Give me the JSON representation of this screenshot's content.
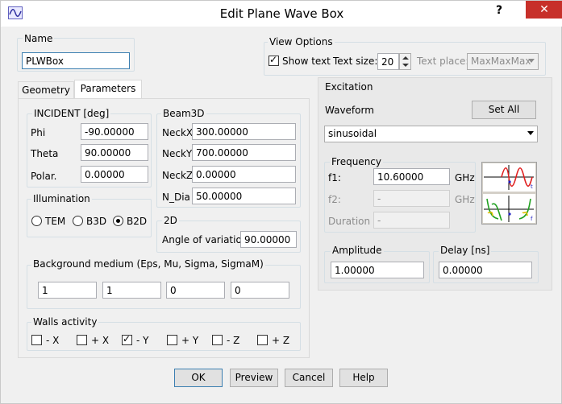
{
  "window": {
    "title": "Edit Plane Wave Box",
    "help": "?",
    "close": "✕"
  },
  "name_group": {
    "legend": "Name",
    "value": "PLWBox"
  },
  "view_options": {
    "legend": "View Options",
    "show_text_label": "Show text",
    "show_text_checked": true,
    "text_size_label": "Text size:",
    "text_size_value": "20",
    "text_place_label": "Text place:",
    "text_place_value": "MaxMaxMax"
  },
  "tabs": [
    {
      "label": "Geometry",
      "active": false
    },
    {
      "label": "Parameters",
      "active": true
    }
  ],
  "incident": {
    "legend": "INCIDENT [deg]",
    "phi_label": "Phi",
    "phi": "-90.00000",
    "theta_label": "Theta",
    "theta": "90.00000",
    "polar_label": "Polar.",
    "polar": "0.00000"
  },
  "beam3d": {
    "legend": "Beam3D",
    "neckx_label": "NeckX",
    "neckx": "300.00000",
    "necky_label": "NeckY",
    "necky": "700.00000",
    "neckz_label": "NeckZ",
    "neckz": "0.00000",
    "ndia_label": "N_Dia",
    "ndia": "50.00000"
  },
  "illumination": {
    "legend": "Illumination",
    "options": [
      {
        "label": "TEM",
        "selected": false
      },
      {
        "label": "B3D",
        "selected": false
      },
      {
        "label": "B2D",
        "selected": true
      }
    ]
  },
  "twod": {
    "legend": "2D",
    "angle_label": "Angle of variation",
    "angle": "90.00000"
  },
  "background": {
    "legend": "Background medium (Eps, Mu, Sigma, SigmaM)",
    "values": [
      "1",
      "1",
      "0",
      "0"
    ]
  },
  "walls": {
    "legend": "Walls activity",
    "items": [
      {
        "label": "- X",
        "checked": false
      },
      {
        "label": "+ X",
        "checked": false
      },
      {
        "label": "- Y",
        "checked": true
      },
      {
        "label": "+ Y",
        "checked": false
      },
      {
        "label": "- Z",
        "checked": false
      },
      {
        "label": "+ Z",
        "checked": false
      }
    ]
  },
  "excitation": {
    "legend": "Excitation",
    "waveform_label": "Waveform",
    "set_all": "Set All",
    "waveform_value": "sinusoidal",
    "frequency": {
      "legend": "Frequency",
      "f1_label": "f1:",
      "f1": "10.60000",
      "f1_unit": "GHz",
      "f2_label": "f2:",
      "f2": "-",
      "f2_unit": "GHz",
      "duration_label": "Duration",
      "duration": "-"
    },
    "amplitude": {
      "legend": "Amplitude",
      "value": "1.00000"
    },
    "delay": {
      "legend": "Delay [ns]",
      "value": "0.00000"
    },
    "preview_top_axis_label": "t",
    "preview_bottom_axis_label": "f"
  },
  "buttons": {
    "ok": "OK",
    "preview": "Preview",
    "cancel": "Cancel",
    "help": "Help"
  }
}
